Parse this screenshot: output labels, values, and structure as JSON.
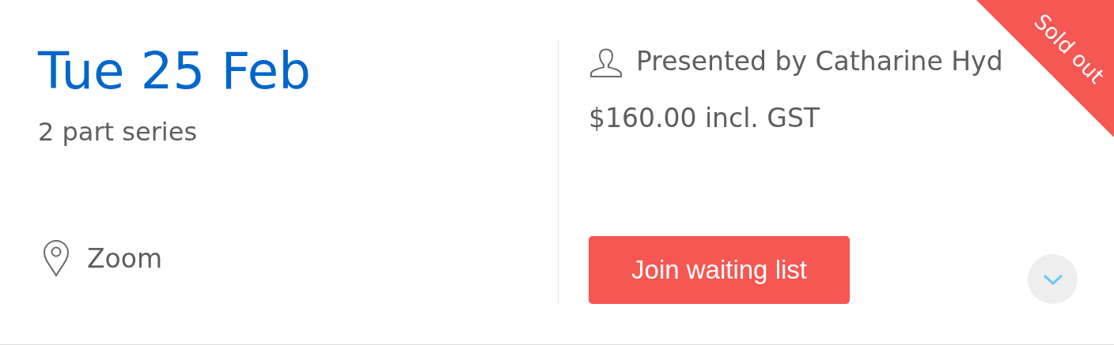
{
  "date": "Tue 25 Feb",
  "series": "2 part series",
  "location": "Zoom",
  "presenter": "Presented by Catharine Hyd",
  "price": "$160.00 incl. GST",
  "button": "Join waiting list",
  "ribbon": "Sold out",
  "expanded": false
}
